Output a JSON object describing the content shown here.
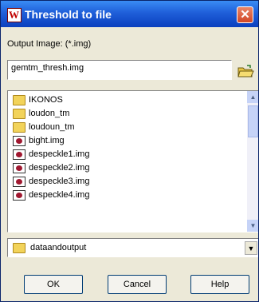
{
  "window": {
    "title": "Threshold to file",
    "close_glyph": "✕",
    "app_icon_letter": "W"
  },
  "output": {
    "label": "Output Image: (*.img)",
    "value": "gemtm_thresh.img"
  },
  "file_list": {
    "items": [
      {
        "name": "IKONOS",
        "icon": "folder-icon"
      },
      {
        "name": "loudon_tm",
        "icon": "folder-icon"
      },
      {
        "name": "loudoun_tm",
        "icon": "folder-icon"
      },
      {
        "name": "bight.img",
        "icon": "image-file-icon"
      },
      {
        "name": "despeckle1.img",
        "icon": "image-file-icon"
      },
      {
        "name": "despeckle2.img",
        "icon": "image-file-icon"
      },
      {
        "name": "despeckle3.img",
        "icon": "image-file-icon"
      },
      {
        "name": "despeckle4.img",
        "icon": "image-file-icon"
      }
    ]
  },
  "directory": {
    "value": "dataandoutput"
  },
  "buttons": {
    "ok": "OK",
    "cancel": "Cancel",
    "help": "Help"
  },
  "colors": {
    "titlebar": "#1f5fd9",
    "dialog_bg": "#ece9d8",
    "close_button": "#d24625",
    "folder": "#f2d35a"
  }
}
